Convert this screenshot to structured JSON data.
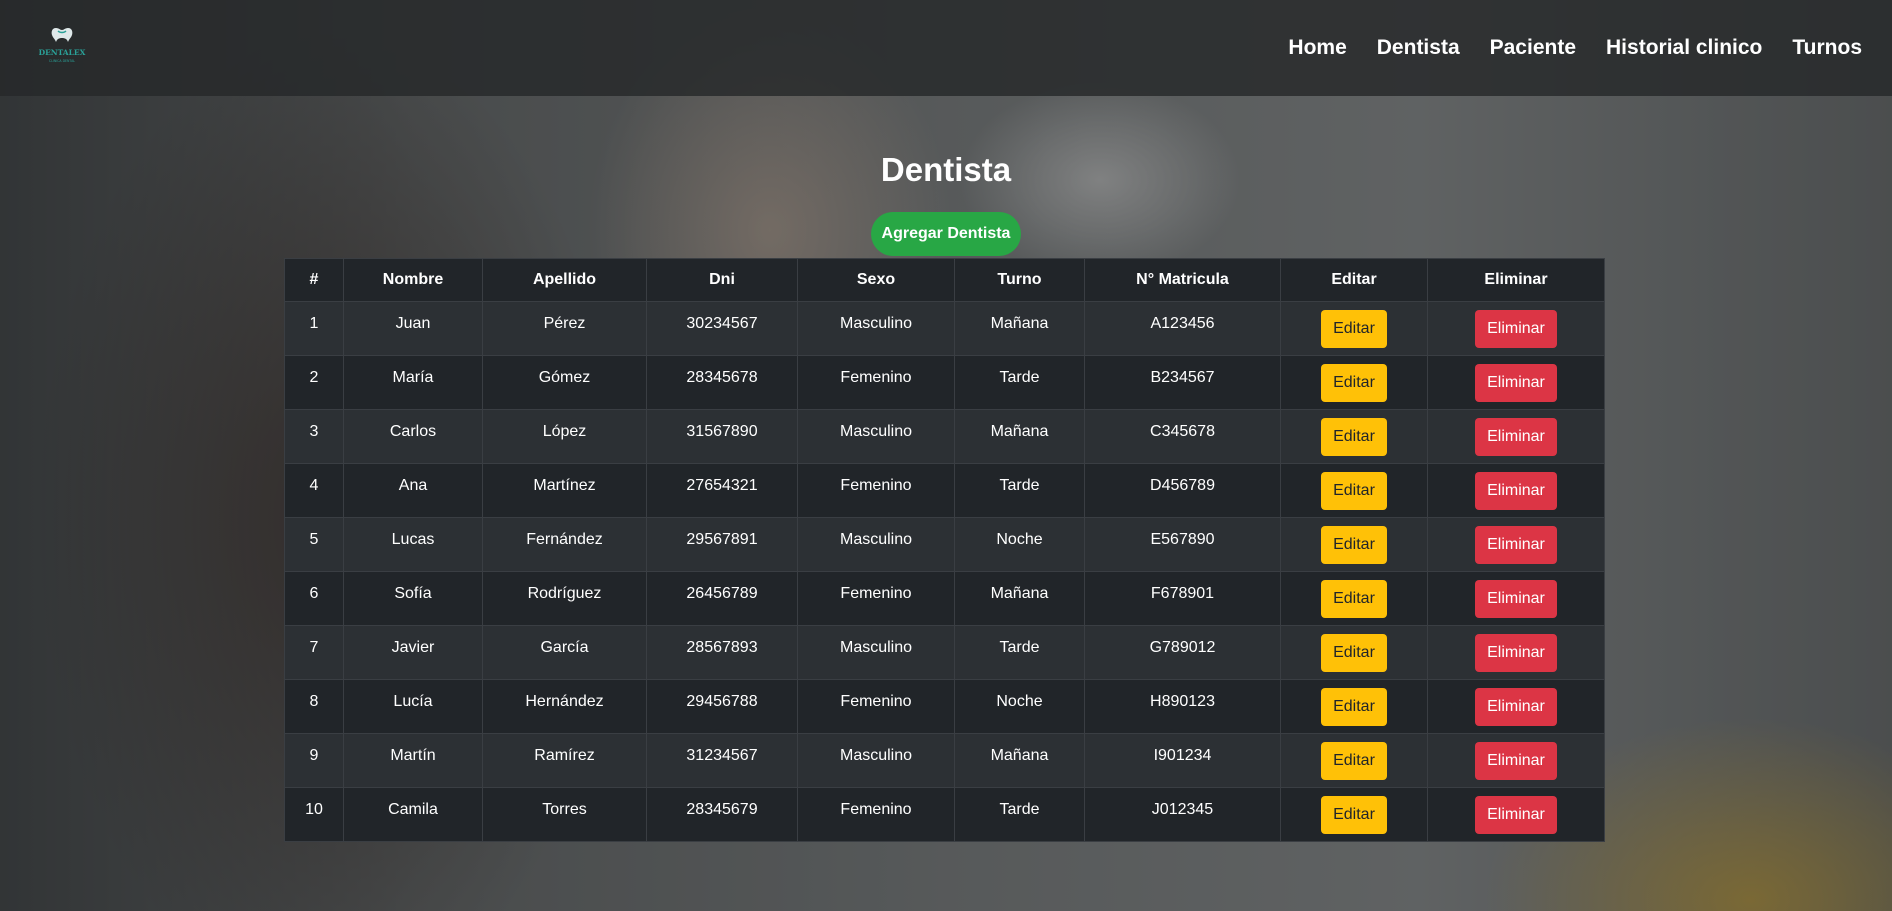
{
  "brand": {
    "logo_text": "DENTALEX",
    "logo_subtext": "CLINICA DENTAL",
    "logo_icon": "tooth-icon",
    "accent_color": "#2aa198"
  },
  "nav": {
    "items": [
      {
        "label": "Home"
      },
      {
        "label": "Dentista"
      },
      {
        "label": "Paciente"
      },
      {
        "label": "Historial clinico"
      },
      {
        "label": "Turnos"
      }
    ]
  },
  "main": {
    "title": "Dentista",
    "add_button_label": "Agregar Dentista",
    "add_button_color": "#28a745"
  },
  "table": {
    "headers": [
      "#",
      "Nombre",
      "Apellido",
      "Dni",
      "Sexo",
      "Turno",
      "N° Matricula",
      "Editar",
      "Eliminar"
    ],
    "edit_label": "Editar",
    "delete_label": "Eliminar",
    "edit_color": "#ffc107",
    "delete_color": "#dc3545",
    "rows": [
      {
        "id": "1",
        "nombre": "Juan",
        "apellido": "Pérez",
        "dni": "30234567",
        "sexo": "Masculino",
        "turno": "Mañana",
        "matricula": "A123456"
      },
      {
        "id": "2",
        "nombre": "María",
        "apellido": "Gómez",
        "dni": "28345678",
        "sexo": "Femenino",
        "turno": "Tarde",
        "matricula": "B234567"
      },
      {
        "id": "3",
        "nombre": "Carlos",
        "apellido": "López",
        "dni": "31567890",
        "sexo": "Masculino",
        "turno": "Mañana",
        "matricula": "C345678"
      },
      {
        "id": "4",
        "nombre": "Ana",
        "apellido": "Martínez",
        "dni": "27654321",
        "sexo": "Femenino",
        "turno": "Tarde",
        "matricula": "D456789"
      },
      {
        "id": "5",
        "nombre": "Lucas",
        "apellido": "Fernández",
        "dni": "29567891",
        "sexo": "Masculino",
        "turno": "Noche",
        "matricula": "E567890"
      },
      {
        "id": "6",
        "nombre": "Sofía",
        "apellido": "Rodríguez",
        "dni": "26456789",
        "sexo": "Femenino",
        "turno": "Mañana",
        "matricula": "F678901"
      },
      {
        "id": "7",
        "nombre": "Javier",
        "apellido": "García",
        "dni": "28567893",
        "sexo": "Masculino",
        "turno": "Tarde",
        "matricula": "G789012"
      },
      {
        "id": "8",
        "nombre": "Lucía",
        "apellido": "Hernández",
        "dni": "29456788",
        "sexo": "Femenino",
        "turno": "Noche",
        "matricula": "H890123"
      },
      {
        "id": "9",
        "nombre": "Martín",
        "apellido": "Ramírez",
        "dni": "31234567",
        "sexo": "Masculino",
        "turno": "Mañana",
        "matricula": "I901234"
      },
      {
        "id": "10",
        "nombre": "Camila",
        "apellido": "Torres",
        "dni": "28345679",
        "sexo": "Femenino",
        "turno": "Tarde",
        "matricula": "J012345"
      }
    ]
  }
}
